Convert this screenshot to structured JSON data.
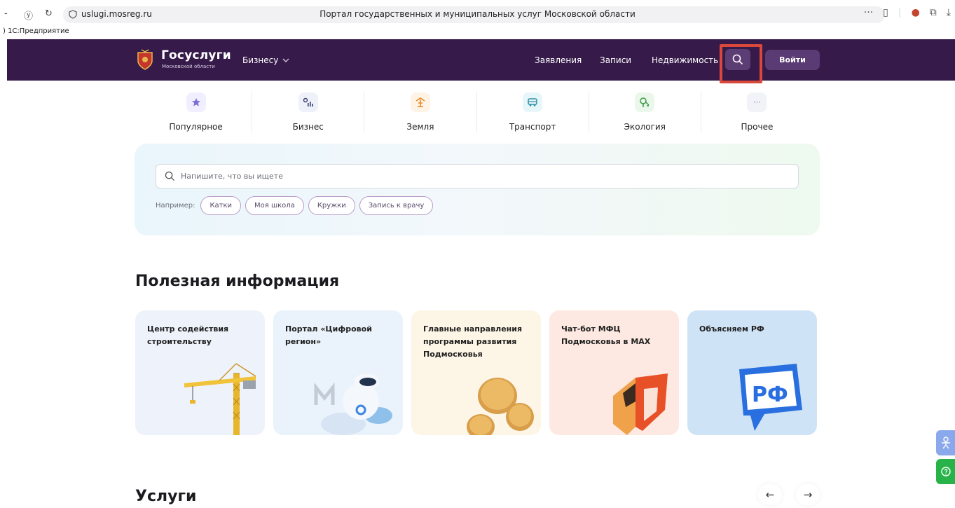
{
  "browser": {
    "url": "uslugi.mosreg.ru",
    "page_title": "Портал государственных и муниципальных услуг Московской области",
    "bookmark": ") 1С:Предприятие"
  },
  "header": {
    "logo_title": "Госуслуги",
    "logo_subtitle": "Московской области",
    "business_label": "Бизнесу",
    "nav": [
      "Заявления",
      "Записи",
      "Недвижимость"
    ],
    "login_label": "Войти"
  },
  "categories": [
    {
      "label": "Популярное",
      "icon": "star-icon",
      "color": "#7b6fd6",
      "bg": "#f1efff"
    },
    {
      "label": "Бизнес",
      "icon": "business-chart-icon",
      "color": "#3a3f6e",
      "bg": "#eef0fa"
    },
    {
      "label": "Земля",
      "icon": "land-icon",
      "color": "#e98a25",
      "bg": "#fff3e6"
    },
    {
      "label": "Транспорт",
      "icon": "bus-icon",
      "color": "#2b8fa8",
      "bg": "#e7f6f9"
    },
    {
      "label": "Экология",
      "icon": "tree-icon",
      "color": "#3a9a45",
      "bg": "#eaf7ea"
    },
    {
      "label": "Прочее",
      "icon": "more-icon",
      "color": "#8d8fb0",
      "bg": "#f2f3f8"
    }
  ],
  "search": {
    "placeholder": "Напишите, что вы ищете",
    "examples_label": "Например:",
    "examples": [
      "Катки",
      "Моя школа",
      "Кружки",
      "Запись к врачу"
    ]
  },
  "info": {
    "title": "Полезная информация",
    "cards": [
      {
        "title": "Центр содействия строительству",
        "bg": "#eef2fb",
        "icon": "crane-icon"
      },
      {
        "title": "Портал «Цифровой регион»",
        "bg": "#eaf3fb",
        "icon": "robot-icon"
      },
      {
        "title": "Главные направления программы развития Подмосковья",
        "bg": "#fdf5e6",
        "icon": "coins-icon"
      },
      {
        "title": "Чат-бот МФЦ Подмосковья в MAX",
        "bg": "#fde9e1",
        "icon": "mfc-logo-icon"
      },
      {
        "title": "Объясняем РФ",
        "bg": "#cfe3f6",
        "icon": "rf-badge-icon"
      }
    ]
  },
  "services": {
    "title": "Услуги",
    "prev": "←",
    "next": "→"
  }
}
